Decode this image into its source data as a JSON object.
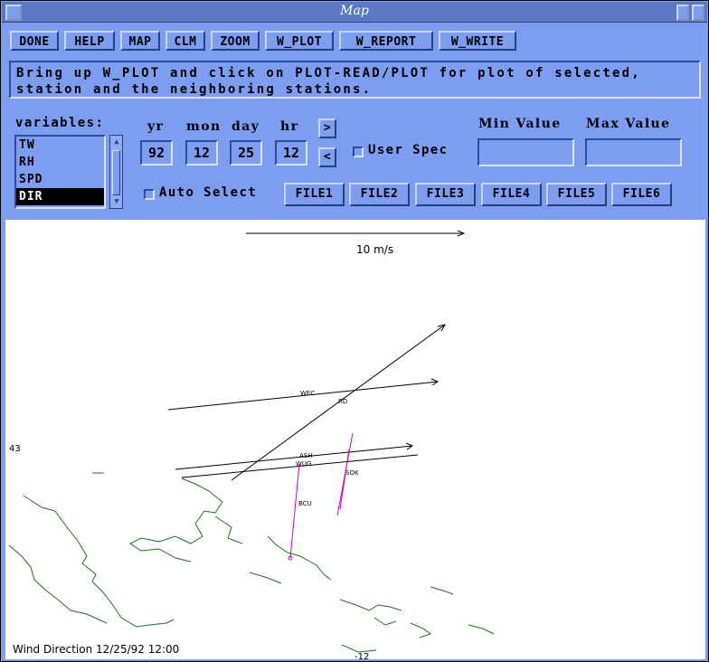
{
  "window": {
    "title": "Map"
  },
  "toolbar": {
    "done": "DONE",
    "help": "HELP",
    "map": "MAP",
    "clm": "CLM",
    "zoom": "ZOOM",
    "w_plot": "W_PLOT",
    "w_report": "W_REPORT",
    "w_write": "W_WRITE"
  },
  "message": {
    "line1": "Bring up W_PLOT and click on PLOT-READ/PLOT for plot of selected,",
    "line2": "station and the neighboring stations."
  },
  "variables": {
    "label": "variables:",
    "items": [
      "TW",
      "RH",
      "SPD",
      "DIR"
    ],
    "selected": "DIR"
  },
  "date": {
    "yr_label": "yr",
    "mon_label": "mon",
    "day_label": "day",
    "hr_label": "hr",
    "yr": "92",
    "mon": "12",
    "day": "25",
    "hr": "12",
    "next": ">",
    "prev": "<"
  },
  "user_spec": {
    "label": "User Spec",
    "checked": false
  },
  "range": {
    "min_label": "Min Value",
    "max_label": "Max Value",
    "min": "",
    "max": ""
  },
  "auto_select": {
    "label": "Auto Select",
    "checked": false
  },
  "files": [
    "FILE1",
    "FILE2",
    "FILE3",
    "FILE4",
    "FILE5",
    "FILE6"
  ],
  "map": {
    "scale_label": "10 m/s",
    "lat_label": "43",
    "lat_label_bottom": "-12",
    "stations": [
      "WEC",
      "RD",
      "ASH",
      "WUG",
      "BCU",
      "SOK"
    ],
    "footer": "Wind Direction 12/25/92 12:00",
    "colors": {
      "vector": "#000000",
      "highlight": "#cc00cc",
      "coast": "#1f6e1f"
    }
  }
}
